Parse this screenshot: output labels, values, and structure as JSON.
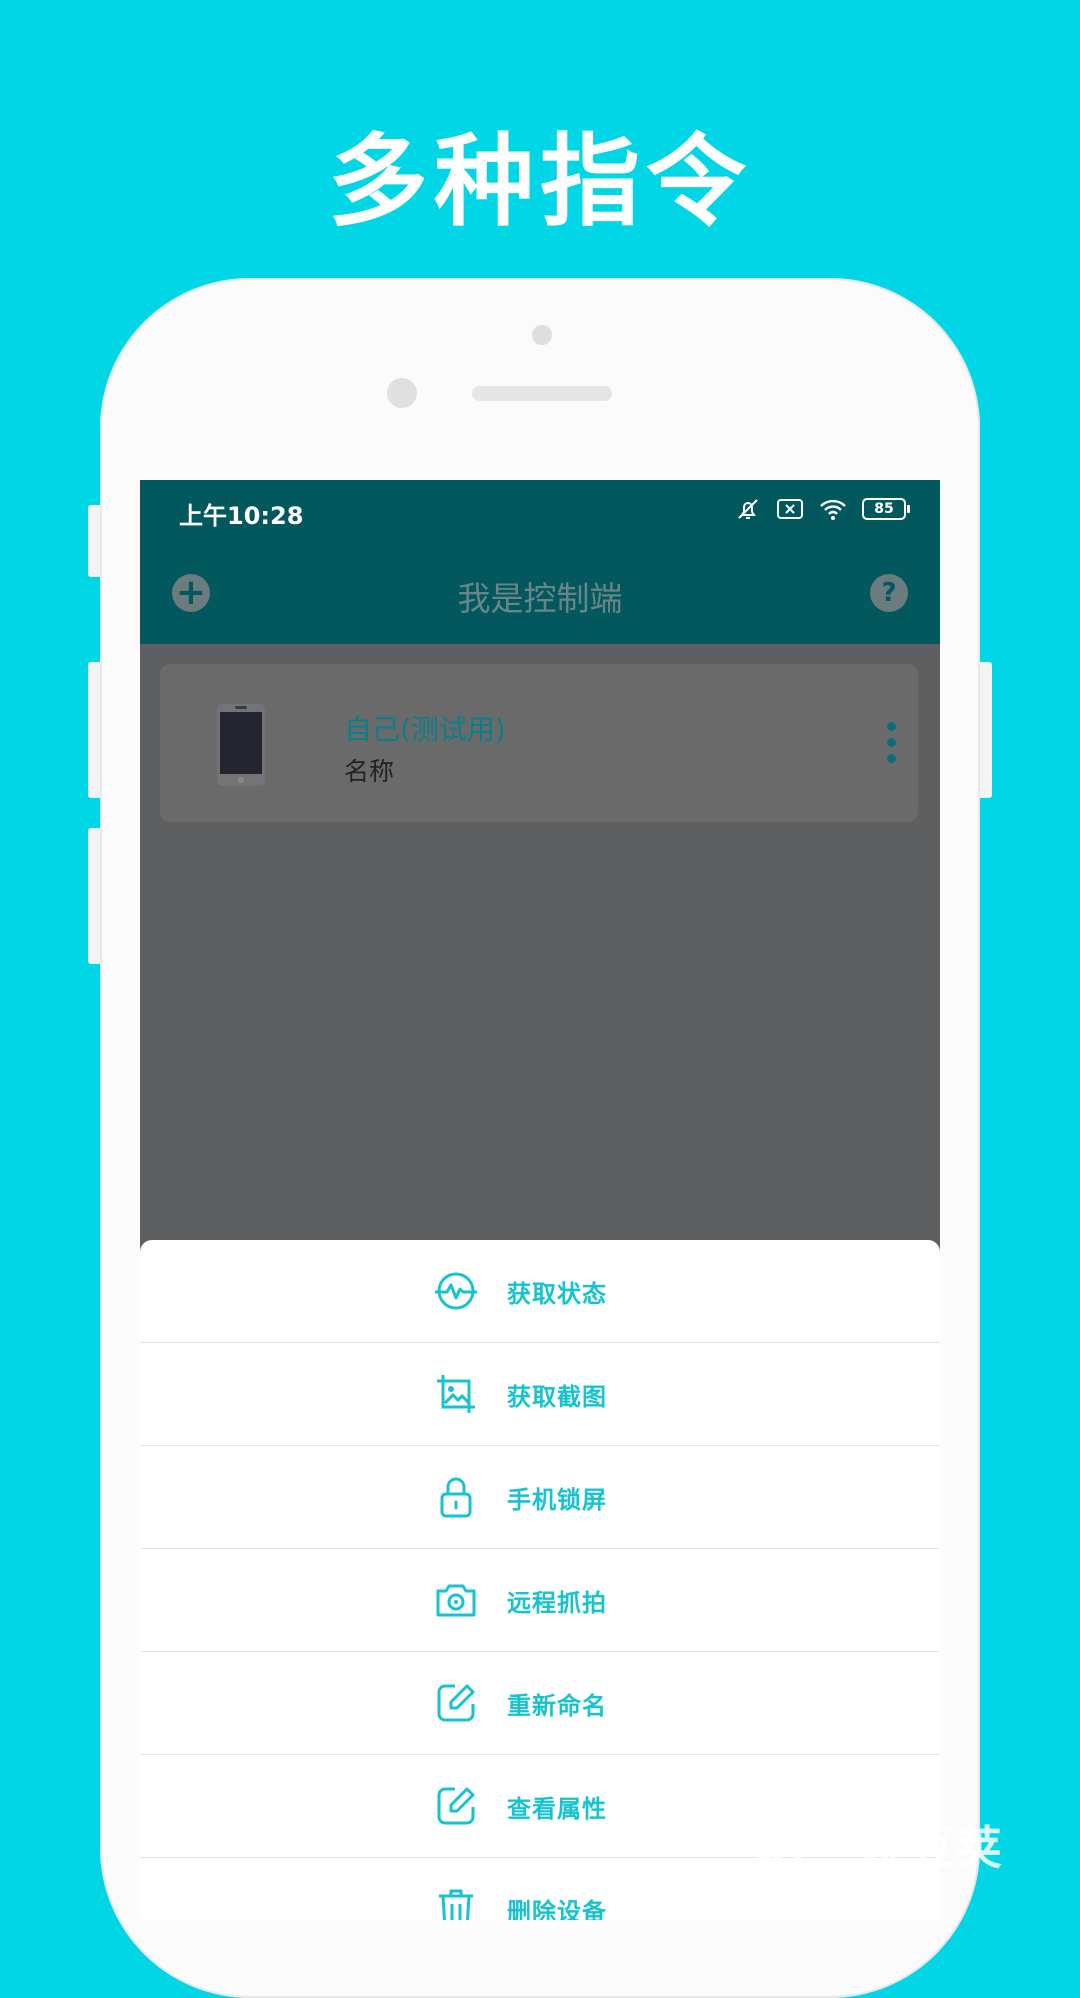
{
  "promo": {
    "title": "多种指令"
  },
  "status_bar": {
    "time": "上午10:28",
    "battery": "85"
  },
  "toolbar": {
    "title": "我是控制端",
    "add_icon": "plus-icon",
    "help_icon": "question-icon",
    "help_glyph": "?"
  },
  "device": {
    "name": "自己(测试用)",
    "subtitle": "名称"
  },
  "menu": {
    "items": [
      {
        "label": "获取状态",
        "icon": "heartbeat-icon"
      },
      {
        "label": "获取截图",
        "icon": "screenshot-icon"
      },
      {
        "label": "手机锁屏",
        "icon": "lock-icon"
      },
      {
        "label": "远程抓拍",
        "icon": "camera-icon"
      },
      {
        "label": "重新命名",
        "icon": "edit-icon"
      },
      {
        "label": "查看属性",
        "icon": "edit-icon"
      },
      {
        "label": "删除设备",
        "icon": "trash-icon"
      }
    ]
  },
  "watermark": {
    "text": "豌豆荚"
  },
  "colors": {
    "background": "#00D6E6",
    "accent": "#17C3CF",
    "toolbar": "#02585D"
  }
}
